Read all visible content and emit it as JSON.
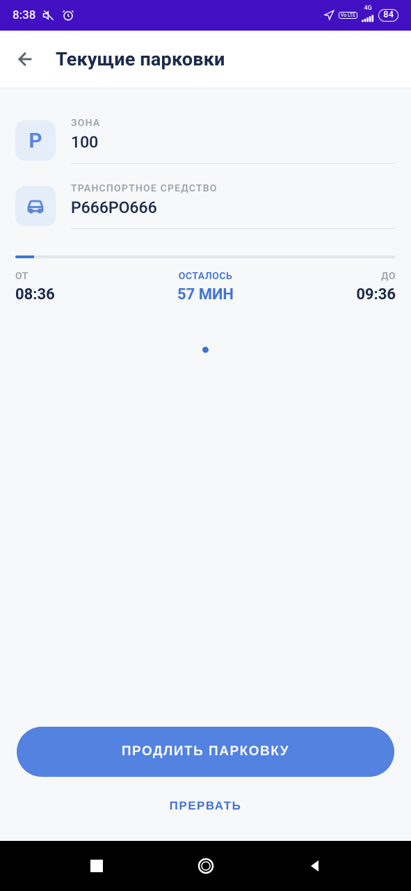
{
  "status": {
    "time": "8:38",
    "network_badge": "Vo LTE",
    "signal_gen": "4G",
    "battery": "84"
  },
  "header": {
    "title": "Текущие парковки"
  },
  "zone": {
    "label": "ЗОНА",
    "value": "100",
    "icon_letter": "P"
  },
  "vehicle": {
    "label": "ТРАНСПОРТНОЕ СРЕДСТВО",
    "value": "P666PO666"
  },
  "progress": {
    "percent": 5
  },
  "times": {
    "from_label": "ОТ",
    "from_value": "08:36",
    "remain_label": "ОСТАЛОСЬ",
    "remain_value": "57 мин",
    "to_label": "ДО",
    "to_value": "09:36"
  },
  "actions": {
    "extend": "ПРОДЛИТЬ ПАРКОВКУ",
    "cancel": "ПРЕРВАТЬ"
  }
}
